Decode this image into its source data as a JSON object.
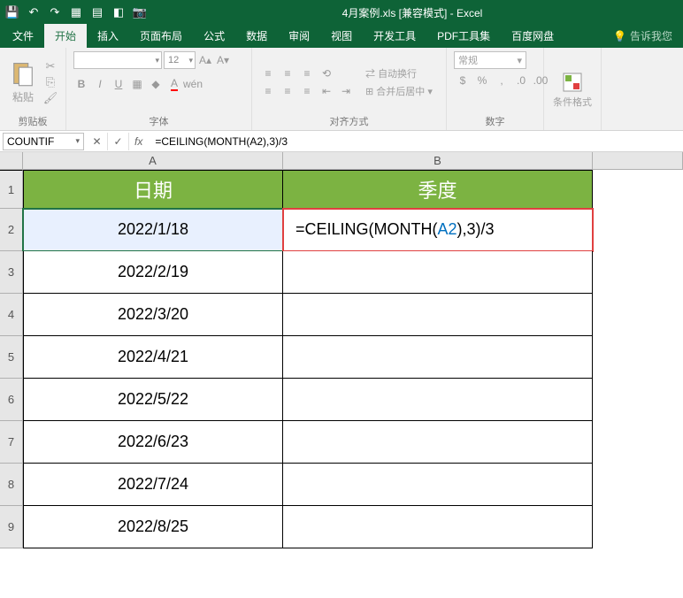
{
  "title": "4月案例.xls [兼容模式] - Excel",
  "tabs": {
    "file": "文件",
    "home": "开始",
    "insert": "插入",
    "layout": "页面布局",
    "formulas": "公式",
    "data": "数据",
    "review": "审阅",
    "view": "视图",
    "developer": "开发工具",
    "pdf": "PDF工具集",
    "baidu": "百度网盘",
    "tell_me": "告诉我您"
  },
  "ribbon": {
    "paste": "粘贴",
    "clipboard": "剪贴板",
    "font_group": "字体",
    "font_name": "",
    "font_size": "12",
    "align_group": "对齐方式",
    "wrap": "自动换行",
    "merge": "合并后居中",
    "number_group": "数字",
    "number_format": "常规",
    "cond_format": "条件格式"
  },
  "formula_bar": {
    "name_box": "COUNTIF",
    "cancel": "✕",
    "enter": "✓",
    "formula": "=CEILING(MONTH(A2),3)/3"
  },
  "columns": {
    "a": "A",
    "b": "B"
  },
  "headers": {
    "a": "日期",
    "b": "季度"
  },
  "rows": {
    "2": {
      "a": "2022/1/18",
      "b_prefix": "=CEILING(MONTH(",
      "b_ref": "A2",
      "b_suffix": "),3)/3"
    },
    "3": {
      "a": "2022/2/19"
    },
    "4": {
      "a": "2022/3/20"
    },
    "5": {
      "a": "2022/4/21"
    },
    "6": {
      "a": "2022/5/22"
    },
    "7": {
      "a": "2022/6/23"
    },
    "8": {
      "a": "2022/7/24"
    },
    "9": {
      "a": "2022/8/25"
    }
  },
  "row_nums": {
    "1": "1",
    "2": "2",
    "3": "3",
    "4": "4",
    "5": "5",
    "6": "6",
    "7": "7",
    "8": "8",
    "9": "9"
  }
}
